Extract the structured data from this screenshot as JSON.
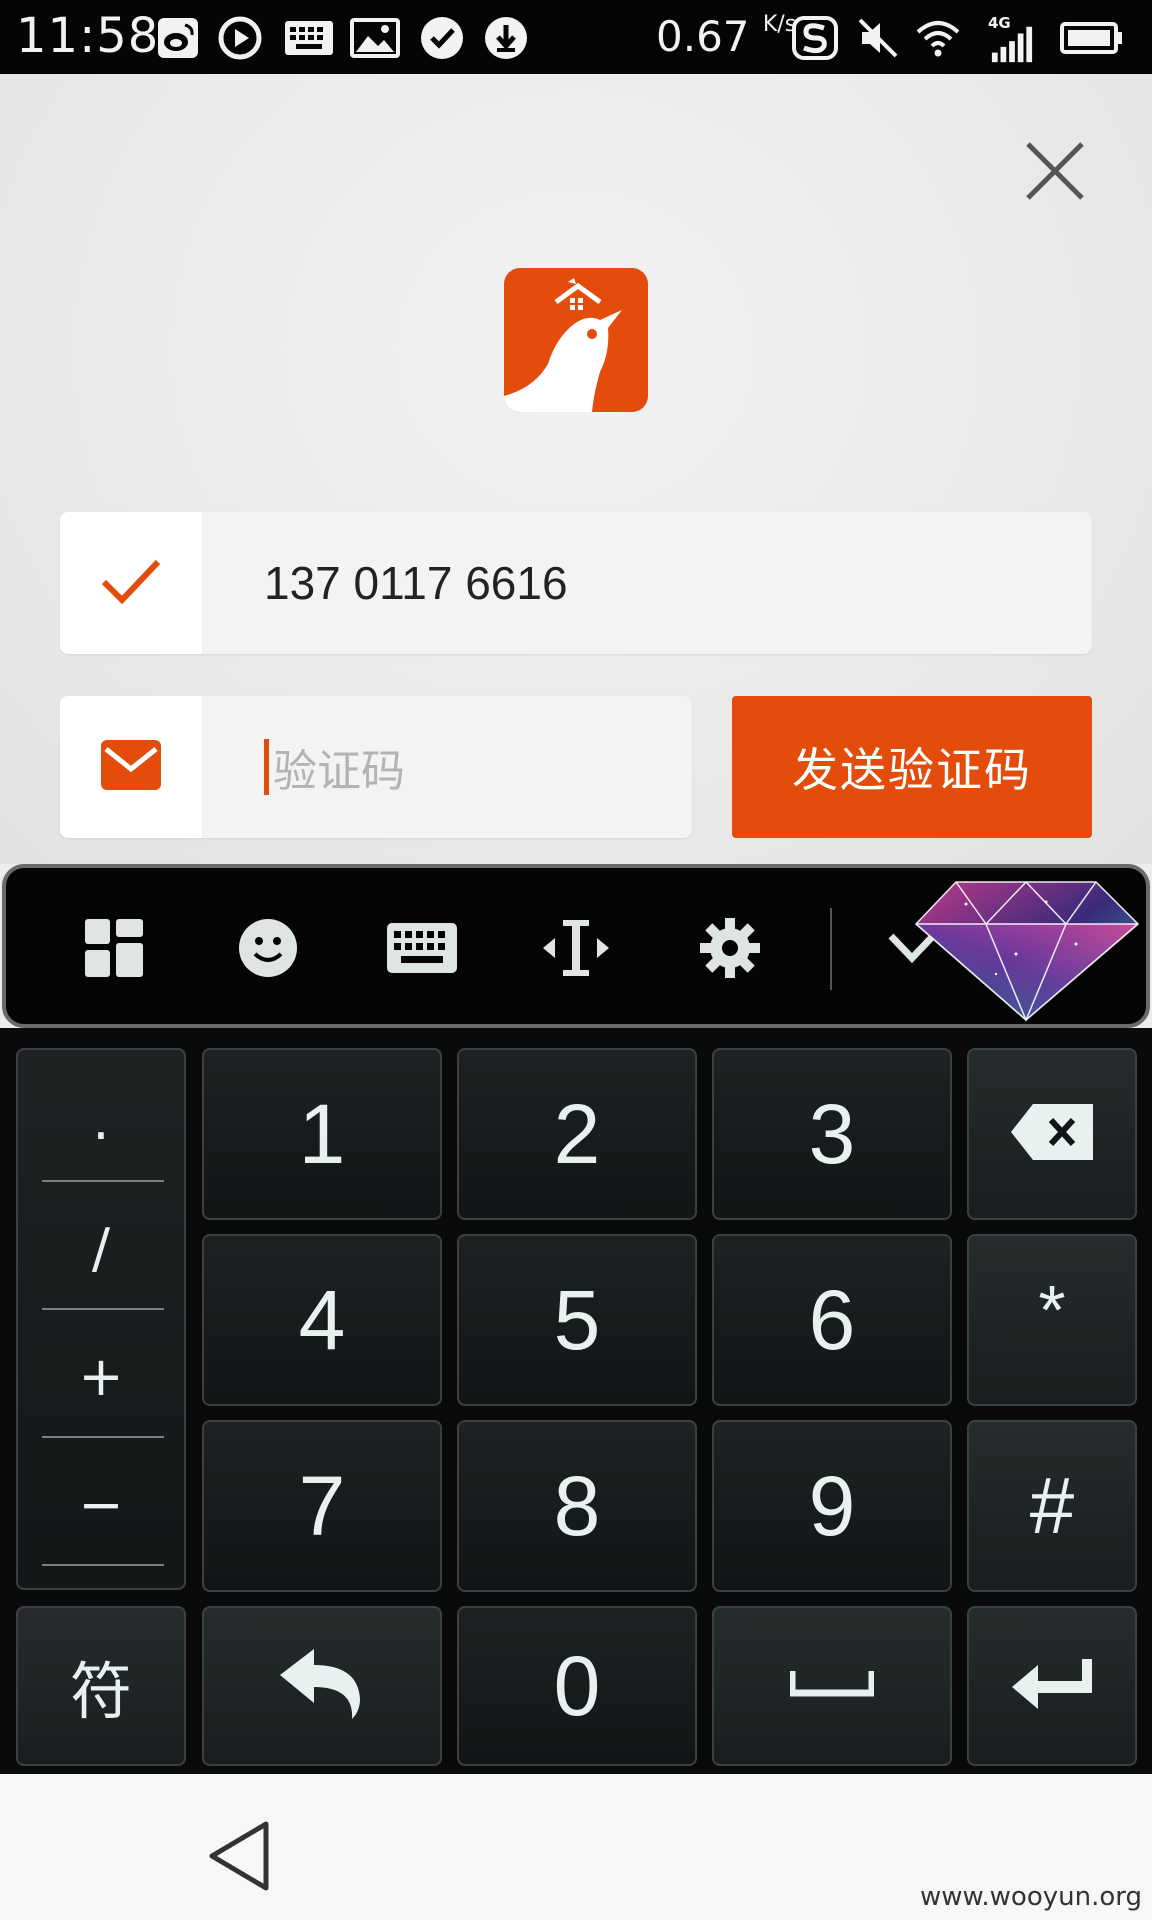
{
  "status_bar": {
    "time": "11:58",
    "speed": "0.67",
    "speed_unit": "K/s",
    "network": "4G",
    "icons": [
      "weibo-icon",
      "play-icon",
      "keyboard-icon",
      "image-icon",
      "check-circle-icon",
      "download-icon",
      "sogou-icon",
      "mute-icon",
      "wifi-icon",
      "signal-icon",
      "battery-icon"
    ]
  },
  "form": {
    "phone_value": "137 0117 6616",
    "code_placeholder": "验证码",
    "send_code_label": "发送验证码"
  },
  "keyboard": {
    "toolbar_icons": [
      "grid-icon",
      "emoji-icon",
      "keyboard-icon",
      "cursor-move-icon",
      "gear-icon",
      "chevron-down-icon"
    ],
    "symbols": [
      ".",
      "/",
      "+",
      "−"
    ],
    "digits": [
      "1",
      "2",
      "3",
      "4",
      "5",
      "6",
      "7",
      "8",
      "9",
      "0"
    ],
    "right_keys": [
      "*",
      "#"
    ],
    "fu_label": "符"
  },
  "colors": {
    "accent": "#e34c0b",
    "keyboard_bg": "#0a0a0a"
  },
  "watermark": "www.wooyun.org"
}
